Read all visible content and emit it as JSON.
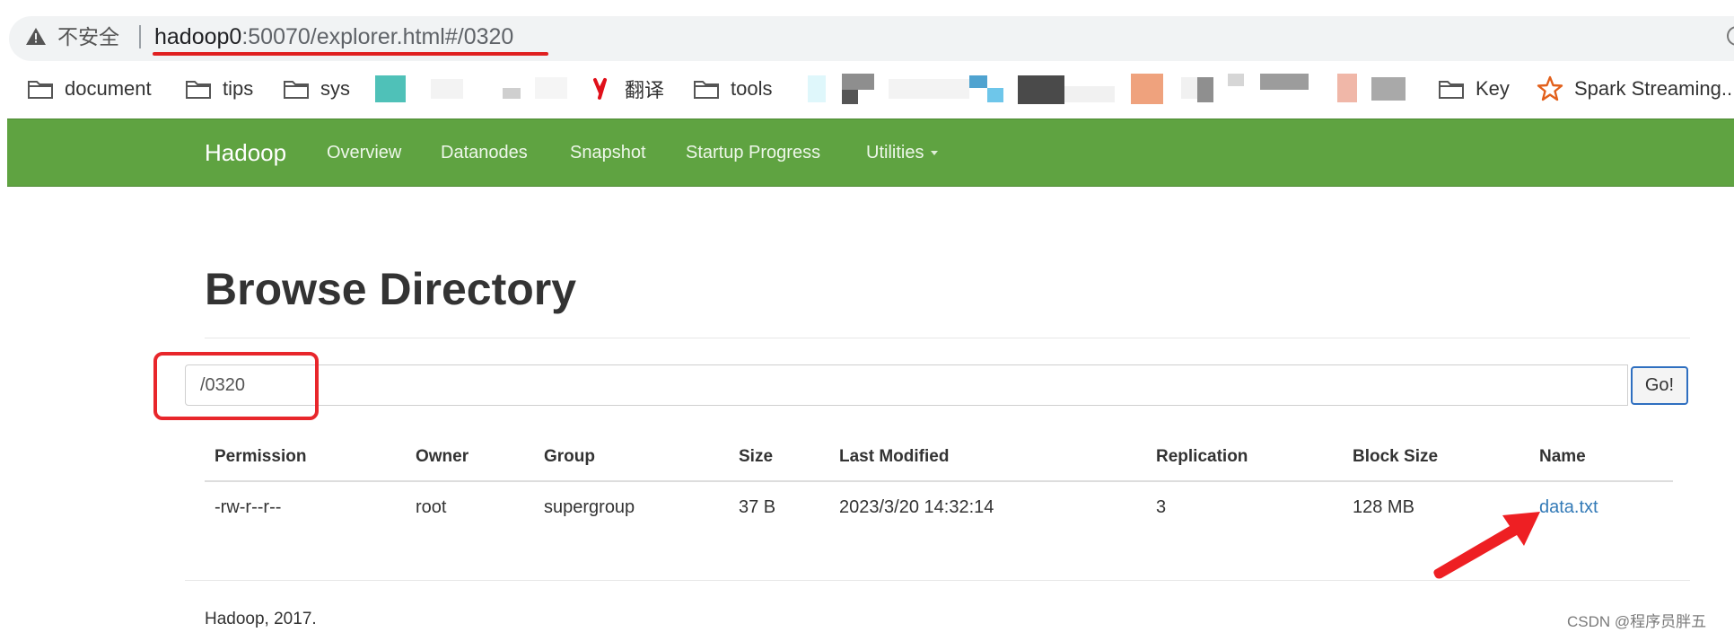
{
  "address_bar": {
    "security_label": "不安全",
    "host": "hadoop0",
    "rest": ":50070/explorer.html#/0320"
  },
  "bookmarks": [
    {
      "label": "document",
      "icon": "folder-icon"
    },
    {
      "label": "tips",
      "icon": "folder-icon"
    },
    {
      "label": "sys",
      "icon": "folder-icon"
    },
    {
      "label": "翻译",
      "icon": "youdao-icon"
    },
    {
      "label": "tools",
      "icon": "folder-icon"
    },
    {
      "label": "Key",
      "icon": "folder-icon"
    },
    {
      "label": "Spark Streaming...",
      "icon": "spark-star-icon"
    }
  ],
  "navbar": {
    "brand": "Hadoop",
    "items": [
      "Overview",
      "Datanodes",
      "Snapshot",
      "Startup Progress",
      "Utilities"
    ]
  },
  "page": {
    "title": "Browse Directory",
    "path_value": "/0320",
    "go_label": "Go!"
  },
  "table": {
    "headers": [
      "Permission",
      "Owner",
      "Group",
      "Size",
      "Last Modified",
      "Replication",
      "Block Size",
      "Name"
    ],
    "rows": [
      [
        "-rw-r--r--",
        "root",
        "supergroup",
        "37 B",
        "2023/3/20 14:32:14",
        "3",
        "128 MB",
        "data.txt"
      ]
    ]
  },
  "footer": "Hadoop, 2017.",
  "watermark": "CSDN @程序员胖五",
  "colors": {
    "navbar": "#5fa341",
    "annotation": "#e8262b",
    "link": "#337ab7"
  }
}
